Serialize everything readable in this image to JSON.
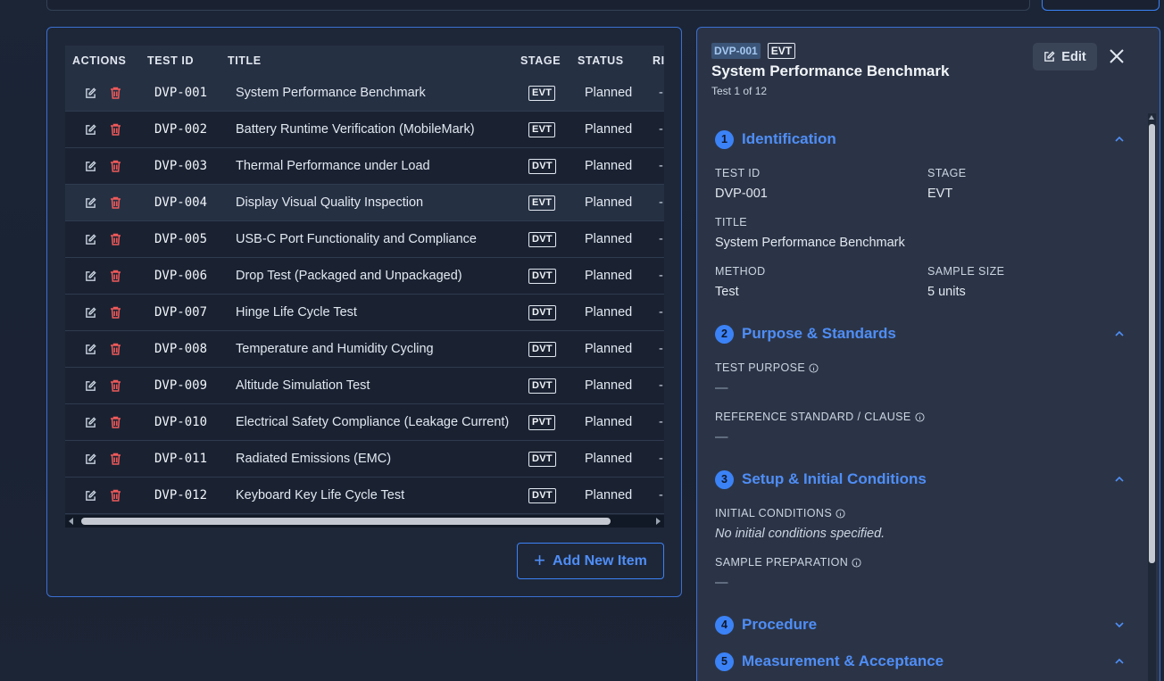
{
  "table": {
    "columns": [
      "ACTIONS",
      "TEST ID",
      "TITLE",
      "STAGE",
      "STATUS",
      "RI"
    ],
    "rows": [
      {
        "id": "DVP-001",
        "title": "System Performance Benchmark",
        "stage": "EVT",
        "status": "Planned",
        "extra": "-"
      },
      {
        "id": "DVP-002",
        "title": "Battery Runtime Verification (MobileMark)",
        "stage": "EVT",
        "status": "Planned",
        "extra": "-"
      },
      {
        "id": "DVP-003",
        "title": "Thermal Performance under Load",
        "stage": "DVT",
        "status": "Planned",
        "extra": "-"
      },
      {
        "id": "DVP-004",
        "title": "Display Visual Quality Inspection",
        "stage": "EVT",
        "status": "Planned",
        "extra": "-"
      },
      {
        "id": "DVP-005",
        "title": "USB-C Port Functionality and Compliance",
        "stage": "DVT",
        "status": "Planned",
        "extra": "-"
      },
      {
        "id": "DVP-006",
        "title": "Drop Test (Packaged and Unpackaged)",
        "stage": "DVT",
        "status": "Planned",
        "extra": "-"
      },
      {
        "id": "DVP-007",
        "title": "Hinge Life Cycle Test",
        "stage": "DVT",
        "status": "Planned",
        "extra": "-"
      },
      {
        "id": "DVP-008",
        "title": "Temperature and Humidity Cycling",
        "stage": "DVT",
        "status": "Planned",
        "extra": "-"
      },
      {
        "id": "DVP-009",
        "title": "Altitude Simulation Test",
        "stage": "DVT",
        "status": "Planned",
        "extra": "-"
      },
      {
        "id": "DVP-010",
        "title": "Electrical Safety Compliance (Leakage Current)",
        "stage": "PVT",
        "status": "Planned",
        "extra": "-"
      },
      {
        "id": "DVP-011",
        "title": "Radiated Emissions (EMC)",
        "stage": "DVT",
        "status": "Planned",
        "extra": "-"
      },
      {
        "id": "DVP-012",
        "title": "Keyboard Key Life Cycle Test",
        "stage": "DVT",
        "status": "Planned",
        "extra": "-"
      }
    ],
    "add_label": "Add New Item"
  },
  "detail": {
    "id_badge": "DVP-001",
    "stage_badge": "EVT",
    "title": "System Performance Benchmark",
    "subtitle": "Test 1 of 12",
    "edit_label": "Edit",
    "sections": [
      {
        "num": "1",
        "title": "Identification"
      },
      {
        "num": "2",
        "title": "Purpose & Standards"
      },
      {
        "num": "3",
        "title": "Setup & Initial Conditions"
      },
      {
        "num": "4",
        "title": "Procedure"
      },
      {
        "num": "5",
        "title": "Measurement & Acceptance"
      }
    ],
    "fields": {
      "test_id_label": "TEST ID",
      "test_id": "DVP-001",
      "stage_label": "STAGE",
      "stage": "EVT",
      "title_label": "TITLE",
      "title": "System Performance Benchmark",
      "method_label": "METHOD",
      "method": "Test",
      "sample_size_label": "SAMPLE SIZE",
      "sample_size": "5 units",
      "purpose_label": "TEST PURPOSE",
      "purpose": "—",
      "reference_label": "REFERENCE STANDARD / CLAUSE",
      "reference": "—",
      "initial_label": "INITIAL CONDITIONS",
      "initial": "No initial conditions specified.",
      "prep_label": "SAMPLE PREPARATION",
      "prep": "—"
    }
  }
}
